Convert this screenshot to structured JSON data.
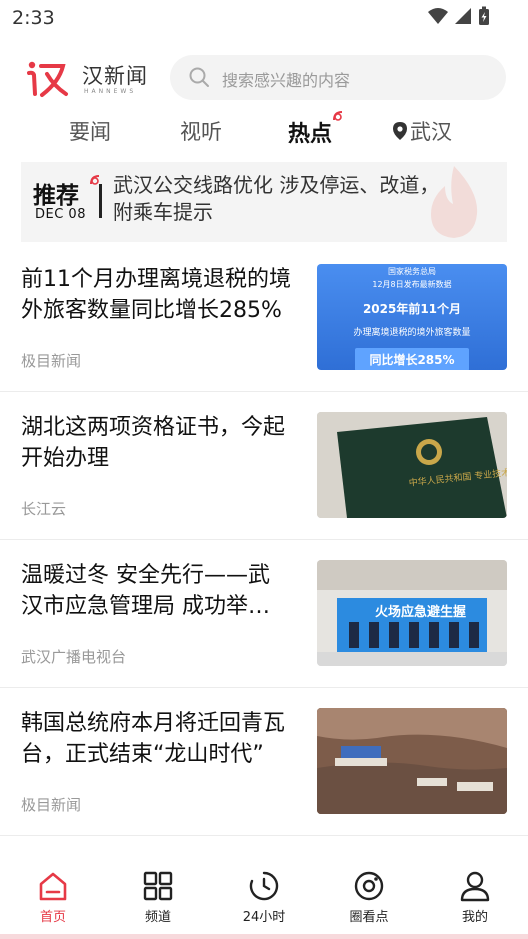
{
  "status_bar": {
    "time": "2:33"
  },
  "header": {
    "logo_text": "汉新闻",
    "logo_subtext": "HANNEWS",
    "search_placeholder": "搜索感兴趣的内容"
  },
  "tabs": [
    {
      "label": "要闻",
      "active": false
    },
    {
      "label": "视听",
      "active": false
    },
    {
      "label": "热点",
      "active": true
    },
    {
      "label": "武汉",
      "active": false
    }
  ],
  "banner": {
    "tag": "推荐",
    "date": "DEC 08",
    "text": "武汉公交线路优化 涉及停运、改道，附乘车提示"
  },
  "news": [
    {
      "title": "前11个月办理离境退税的境外旅客数量同比增长285%",
      "source": "极目新闻",
      "thumb": {
        "line1": "国家税务总局",
        "line2": "12月8日发布最新数据",
        "line3": "2025年前11个月",
        "line4": "办理离境退税的境外旅客数量",
        "line5": "同比增长285%"
      }
    },
    {
      "title": "湖北这两项资格证书，今起开始办理",
      "source": "长江云",
      "thumb": {
        "text": "中华人民共和国 专业技术人员 职业"
      }
    },
    {
      "title": "温暖过冬 安全先行——武汉市应急管理局 成功举办活动",
      "source": "武汉广播电视台",
      "thumb": {
        "text": "火场应急避生握"
      }
    },
    {
      "title": "韩国总统府本月将迁回青瓦台，正式结束“龙山时代”",
      "source": "极目新闻",
      "thumb": {}
    }
  ],
  "bottom_nav": [
    {
      "label": "首页",
      "icon": "home-icon",
      "active": true
    },
    {
      "label": "频道",
      "icon": "grid-icon",
      "active": false
    },
    {
      "label": "24小时",
      "icon": "clock-icon",
      "active": false
    },
    {
      "label": "圈看点",
      "icon": "target-icon",
      "active": false
    },
    {
      "label": "我的",
      "icon": "user-icon",
      "active": false
    }
  ],
  "colors": {
    "brand_red": "#e63946",
    "thumb_blue": "#3a7fe0"
  }
}
